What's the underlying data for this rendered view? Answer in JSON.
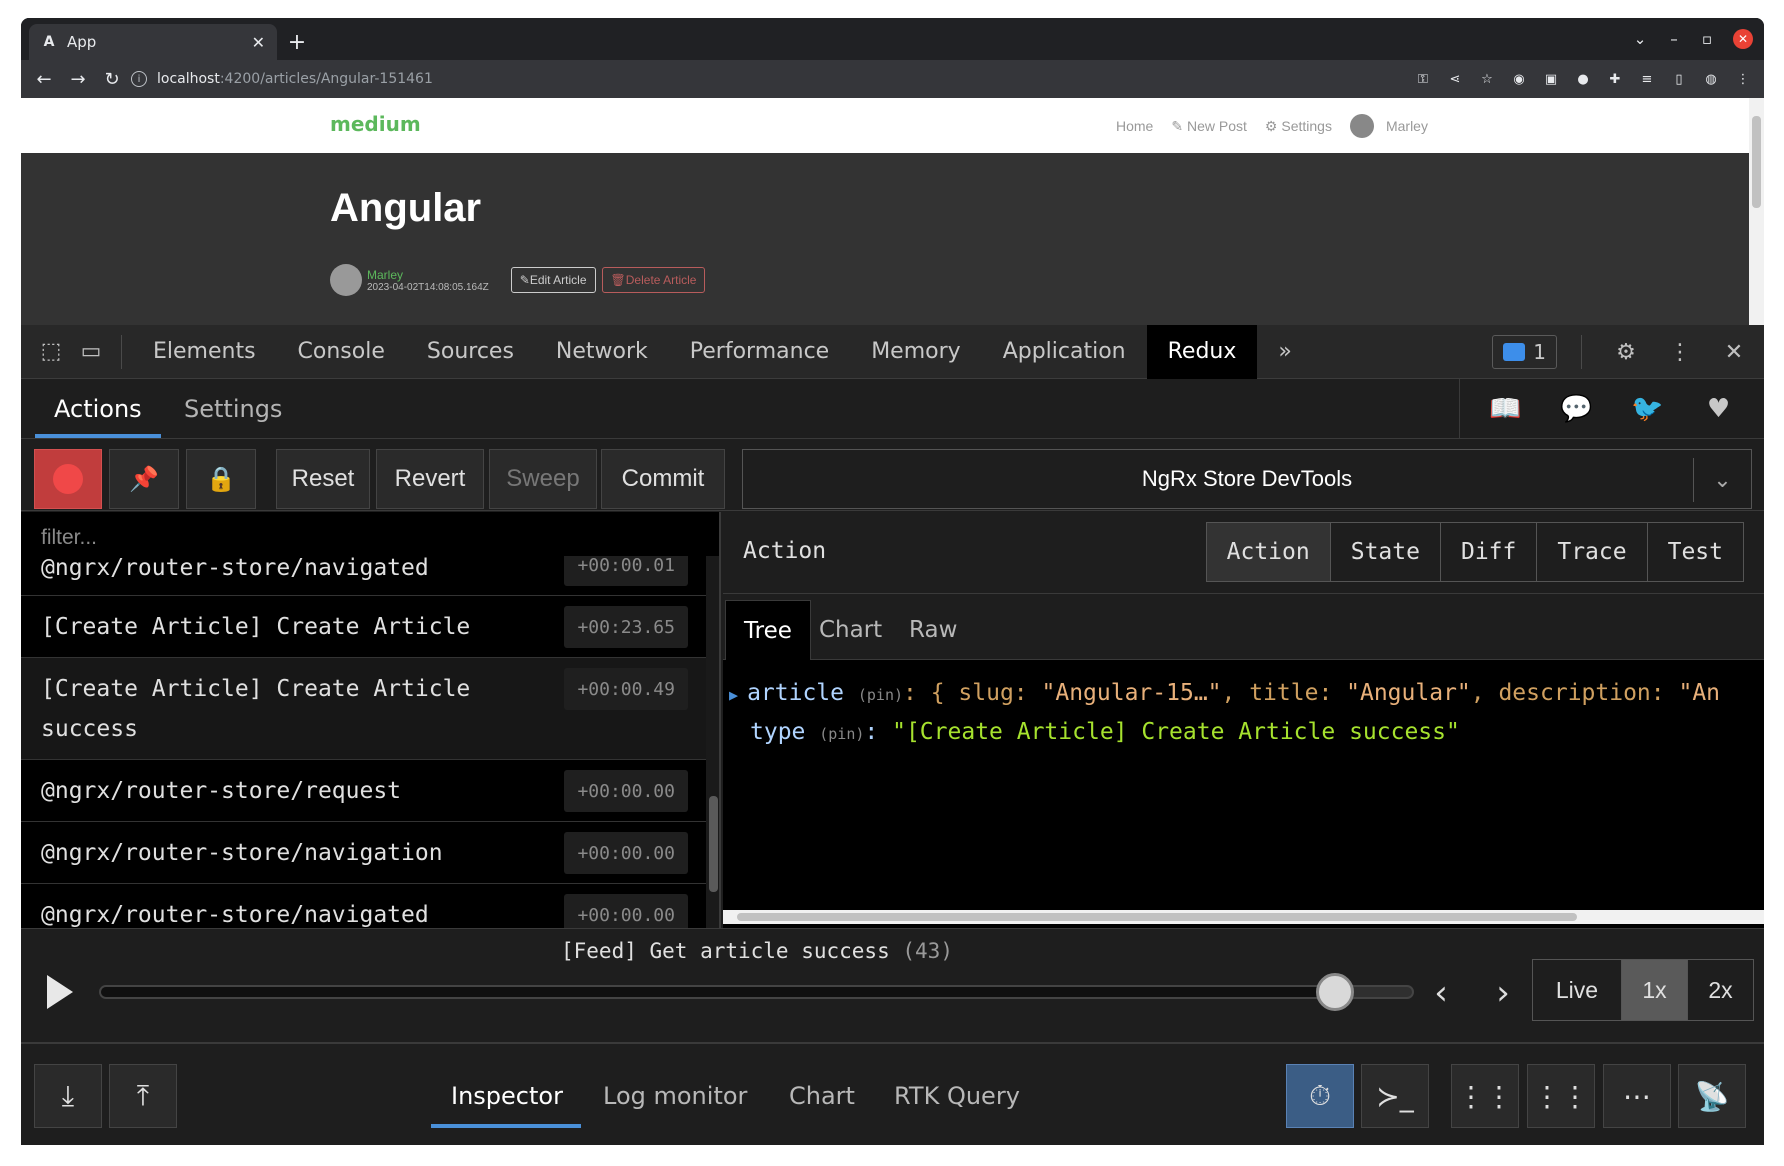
{
  "browser": {
    "tab_title": "App",
    "url_host": "localhost",
    "url_path": ":4200/articles/Angular-151461"
  },
  "site": {
    "brand": "medium",
    "nav": {
      "home": "Home",
      "new_post": "New Post",
      "settings": "Settings",
      "user": "Marley"
    },
    "article": {
      "title": "Angular",
      "author": "Marley",
      "date": "2023-04-02T14:08:05.164Z",
      "edit_label": "Edit Article",
      "delete_label": "Delete Article"
    }
  },
  "devtools": {
    "tabs": [
      "Elements",
      "Console",
      "Sources",
      "Network",
      "Performance",
      "Memory",
      "Application",
      "Redux"
    ],
    "active_tab": "Redux",
    "more_tabs": "»",
    "message_count": "1"
  },
  "redux": {
    "tabs": {
      "actions": "Actions",
      "settings": "Settings"
    },
    "controls": {
      "reset": "Reset",
      "revert": "Revert",
      "sweep": "Sweep",
      "commit": "Commit"
    },
    "instance": "NgRx Store DevTools",
    "filter_placeholder": "filter...",
    "actions": [
      {
        "name": "@ngrx/router-store/navigated",
        "time": "+00:00.01"
      },
      {
        "name": "[Create Article] Create Article",
        "time": "+00:23.65"
      },
      {
        "name": "[Create Article] Create Article",
        "name2": "success",
        "time": "+00:00.49"
      },
      {
        "name": "@ngrx/router-store/request",
        "time": "+00:00.00"
      },
      {
        "name": "@ngrx/router-store/navigation",
        "time": "+00:00.00"
      },
      {
        "name": "@ngrx/router-store/navigated",
        "time": "+00:00.00"
      }
    ],
    "inspector": {
      "title": "Action",
      "tabs": [
        "Action",
        "State",
        "Diff",
        "Trace",
        "Test"
      ],
      "active": "Action",
      "subtabs": [
        "Tree",
        "Chart",
        "Raw"
      ],
      "active_subtab": "Tree",
      "tree": {
        "article_key": "article",
        "pin": "(pin)",
        "article_preview_prefix": ": { ",
        "slug_key": "slug: ",
        "slug_val": "\"Angular-15…\"",
        "title_key": ", title: ",
        "title_val": "\"Angular\"",
        "desc_key": ", description: ",
        "desc_val": "\"An",
        "type_key": "type",
        "type_val": "\"[Create Article] Create Article success\""
      }
    },
    "slider": {
      "action_label": "[Feed] Get article success",
      "action_count": "(43)",
      "position": 0.94,
      "speeds": [
        "Live",
        "1x",
        "2x"
      ],
      "active_speed": "1x"
    },
    "monitors": [
      "Inspector",
      "Log monitor",
      "Chart",
      "RTK Query"
    ],
    "active_monitor": "Inspector"
  }
}
